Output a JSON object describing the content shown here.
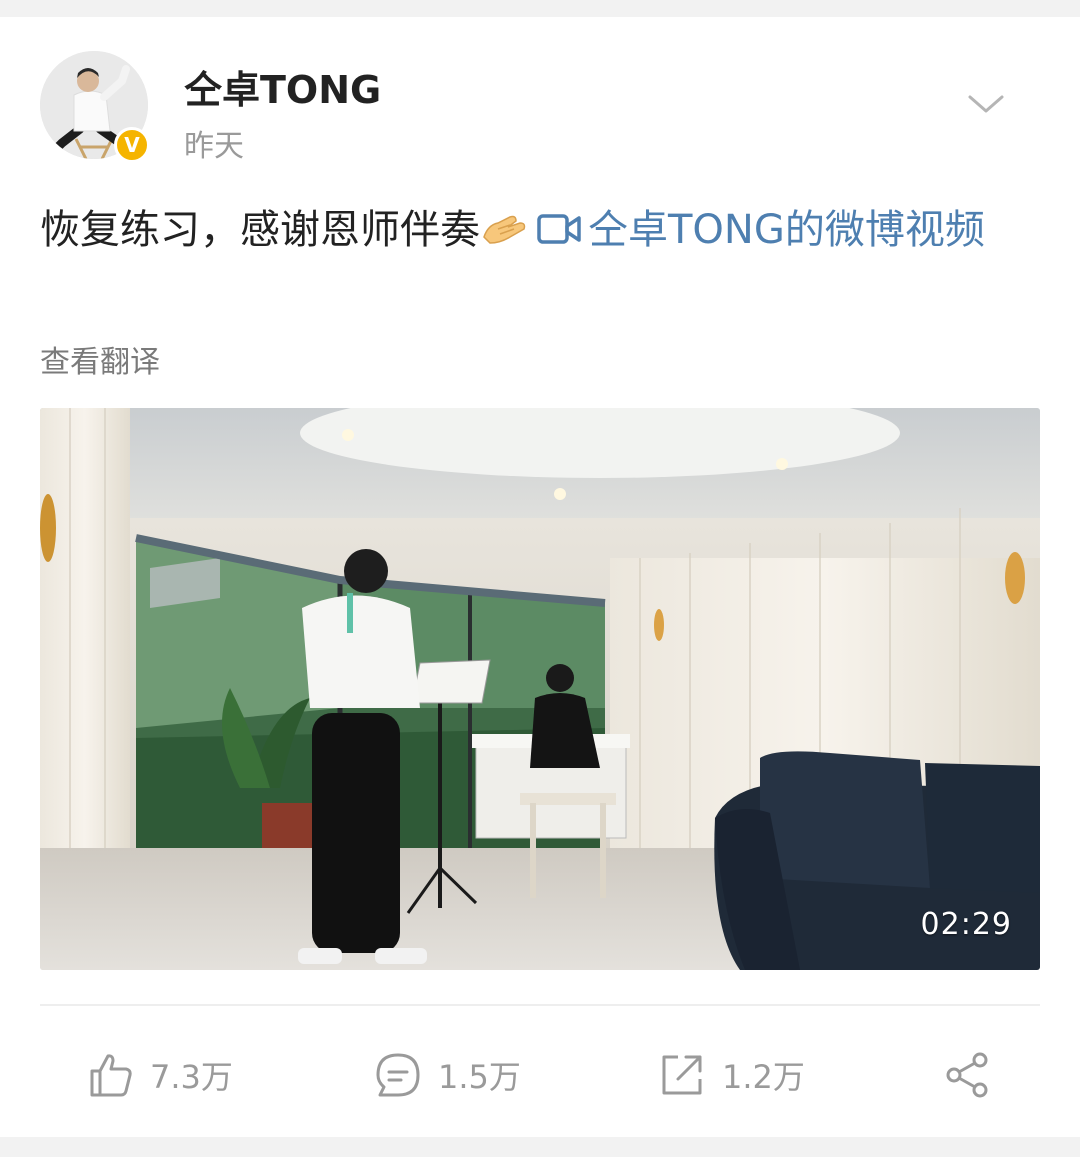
{
  "post": {
    "author": "仝卓TONG",
    "timestamp": "昨天",
    "text": "恢复练习，感谢恩师伴奏",
    "emoji": "pinched-hands-emoji",
    "video_link_label": "仝卓TONG的微博视频",
    "translate_label": "查看翻译",
    "video": {
      "duration": "02:29"
    }
  },
  "actions": {
    "likes": "7.3万",
    "comments": "1.5万",
    "reposts": "1.2万"
  },
  "colors": {
    "link": "#4e7fb0",
    "verified_badge": "#f5b400",
    "meta_text": "#9a9a9a"
  }
}
